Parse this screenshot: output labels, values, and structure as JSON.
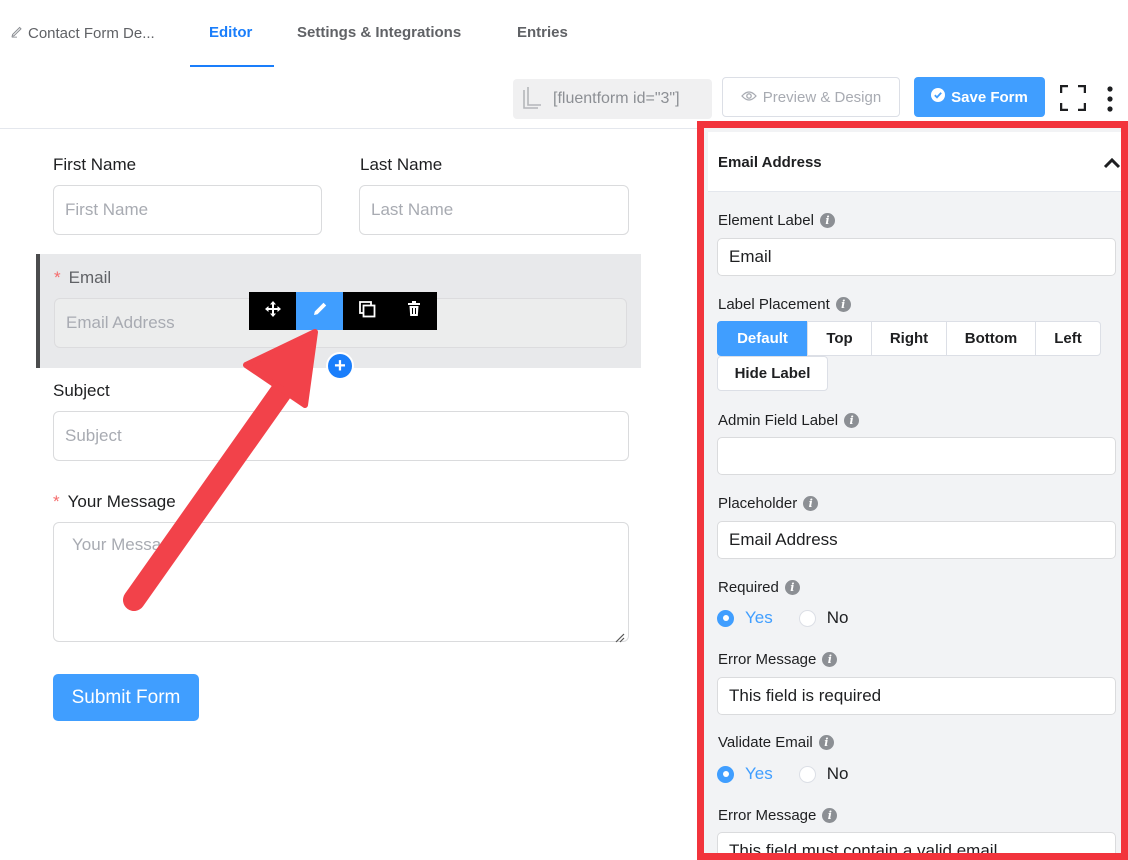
{
  "nav": {
    "form_title": "Contact Form De...",
    "tabs": [
      {
        "label": "Editor"
      },
      {
        "label": "Settings & Integrations"
      },
      {
        "label": "Entries"
      }
    ]
  },
  "toolbar": {
    "shortcode": "[fluentform id=\"3\"]",
    "preview_label": "Preview & Design",
    "save_label": "Save Form"
  },
  "form": {
    "first_name": {
      "label": "First Name",
      "placeholder": "First Name"
    },
    "last_name": {
      "label": "Last Name",
      "placeholder": "Last Name"
    },
    "email": {
      "label": "Email",
      "placeholder": "Email Address",
      "required_mark": "*"
    },
    "subject": {
      "label": "Subject",
      "placeholder": "Subject"
    },
    "message": {
      "label": "Your Message",
      "placeholder": "Your Message",
      "required_mark": "*"
    },
    "submit_label": "Submit Form",
    "add_symbol": "+"
  },
  "panel": {
    "title": "Email Address",
    "element_label": {
      "label": "Element Label",
      "value": "Email"
    },
    "label_placement": {
      "label": "Label Placement",
      "options": [
        "Default",
        "Top",
        "Right",
        "Bottom",
        "Left",
        "Hide Label"
      ],
      "selected": "Default"
    },
    "admin_field_label": {
      "label": "Admin Field Label",
      "value": ""
    },
    "placeholder": {
      "label": "Placeholder",
      "value": "Email Address"
    },
    "required": {
      "label": "Required",
      "yes": "Yes",
      "no": "No",
      "selected": "Yes"
    },
    "required_error": {
      "label": "Error Message",
      "value": "This field is required"
    },
    "validate_email": {
      "label": "Validate Email",
      "yes": "Yes",
      "no": "No",
      "selected": "Yes"
    },
    "validate_error": {
      "label": "Error Message",
      "value": "This field must contain a valid email"
    }
  },
  "colors": {
    "accent": "#409eff",
    "highlight_border": "#f2343c",
    "arrow": "#f2424a"
  }
}
